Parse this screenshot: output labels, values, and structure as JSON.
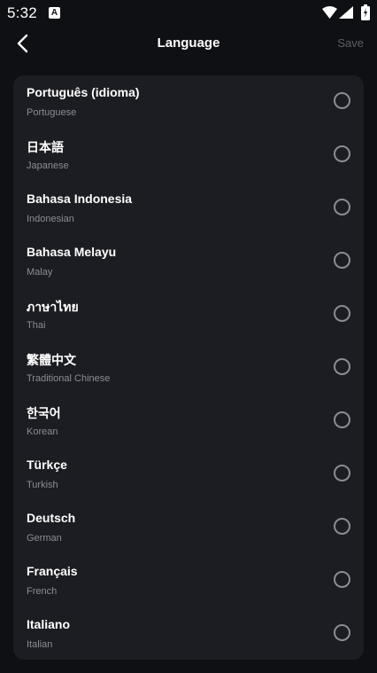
{
  "status_bar": {
    "time": "5:32",
    "notification_icon": "A",
    "icons": [
      "wifi-icon",
      "signal-icon",
      "battery-icon"
    ]
  },
  "header": {
    "back_icon": "chevron-left-icon",
    "title": "Language",
    "save_label": "Save"
  },
  "colors": {
    "background": "#0f1014",
    "card": "#1c1d22",
    "primary_text": "#ffffff",
    "secondary_text": "#8b8d94",
    "disabled_text": "#5d5f66"
  },
  "languages": [
    {
      "native": "Português (idioma)",
      "english": "Portuguese",
      "selected": false
    },
    {
      "native": "日本語",
      "english": "Japanese",
      "selected": false
    },
    {
      "native": "Bahasa Indonesia",
      "english": "Indonesian",
      "selected": false
    },
    {
      "native": "Bahasa Melayu",
      "english": "Malay",
      "selected": false
    },
    {
      "native": "ภาษาไทย",
      "english": "Thai",
      "selected": false
    },
    {
      "native": "繁體中文",
      "english": "Traditional Chinese",
      "selected": false
    },
    {
      "native": "한국어",
      "english": "Korean",
      "selected": false
    },
    {
      "native": "Türkçe",
      "english": "Turkish",
      "selected": false
    },
    {
      "native": "Deutsch",
      "english": "German",
      "selected": false
    },
    {
      "native": "Français",
      "english": "French",
      "selected": false
    },
    {
      "native": "Italiano",
      "english": "Italian",
      "selected": false
    }
  ]
}
